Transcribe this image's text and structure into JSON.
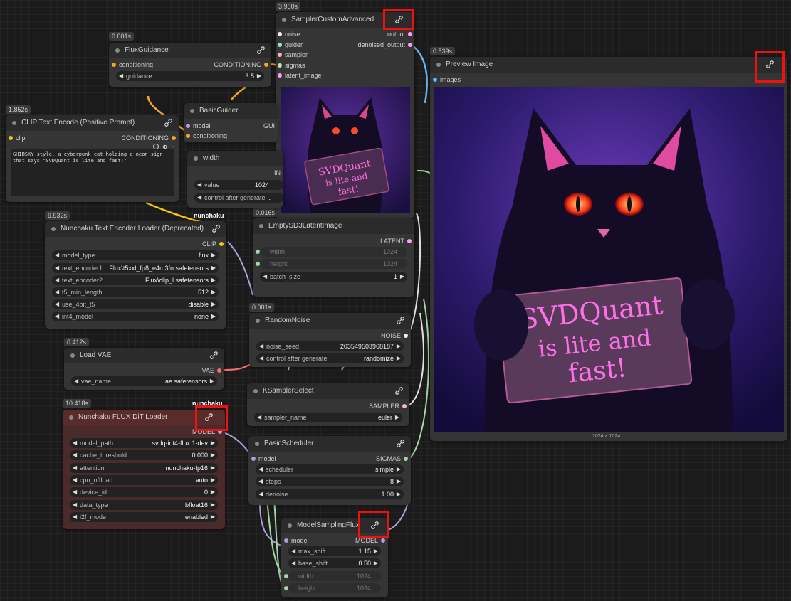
{
  "timings": {
    "sampler": "3.950s",
    "flux_guidance": "0.001s",
    "clip_text": "1.852s",
    "preview": "0.539s",
    "text_loader": "9.932s",
    "latent": "0.016s",
    "random_noise": "0.001s",
    "load_vae": "0.412s",
    "dit_loader": "10.418s"
  },
  "nodes": {
    "sampler": {
      "title": "SamplerCustomAdvanced",
      "inputs": [
        "noise",
        "guider",
        "sampler",
        "sigmas",
        "latent_image"
      ],
      "outputs": [
        "output",
        "denoised_output"
      ]
    },
    "flux_guidance": {
      "title": "FluxGuidance",
      "input": "conditioning",
      "output": "CONDITIONING",
      "guidance_label": "guidance",
      "guidance_value": "3.5"
    },
    "basic_guider": {
      "title": "BasicGuider",
      "inputs": [
        "model",
        "conditioning"
      ],
      "output": "GUI"
    },
    "clip_text": {
      "title": "CLIP Text Encode (Positive Prompt)",
      "input": "clip",
      "output": "CONDITIONING",
      "prompt": "GHIBSKY style, a cyberpunk cat holding a neon sign that says \"SVDQuant is lite and fast!\""
    },
    "width": {
      "title": "width",
      "output": "IN",
      "value_label": "value",
      "value": "1024",
      "control_label": "control after generate",
      "control_value": "."
    },
    "preview": {
      "title": "Preview Image",
      "input": "images",
      "size_label": "1024 × 1024"
    },
    "text_loader": {
      "title": "Nunchaku Text Encoder Loader (Deprecated)",
      "output": "CLIP",
      "widgets": [
        {
          "label": "model_type",
          "value": "flux"
        },
        {
          "label": "text_encoder1",
          "value": "Flux\\t5xxl_fp8_e4m3fn.safetensors"
        },
        {
          "label": "text_encoder2",
          "value": "Flux\\clip_l.safetensors"
        },
        {
          "label": "t5_min_length",
          "value": "512"
        },
        {
          "label": "use_4bit_t5",
          "value": "disable"
        },
        {
          "label": "int4_model",
          "value": "none"
        }
      ]
    },
    "latent": {
      "title": "EmptySD3LatentImage",
      "output": "LATENT",
      "widgets": [
        {
          "label": "width",
          "value": "1024",
          "dim": true
        },
        {
          "label": "height",
          "value": "1024",
          "dim": true
        },
        {
          "label": "batch_size",
          "value": "1",
          "dim": false
        }
      ]
    },
    "random_noise": {
      "title": "RandomNoise",
      "output": "NOISE",
      "widgets": [
        {
          "label": "noise_seed",
          "value": "203549503968187"
        },
        {
          "label": "control after generate",
          "value": "randomize"
        }
      ]
    },
    "load_vae": {
      "title": "Load VAE",
      "output": "VAE",
      "widgets": [
        {
          "label": "vae_name",
          "value": "ae.safetensors"
        }
      ]
    },
    "ksampler_select": {
      "title": "KSamplerSelect",
      "output": "SAMPLER",
      "widgets": [
        {
          "label": "sampler_name",
          "value": "euler"
        }
      ]
    },
    "dit_loader": {
      "title": "Nunchaku FLUX DiT Loader",
      "output": "MODEL",
      "widgets": [
        {
          "label": "model_path",
          "value": "svdq-int4-flux.1-dev"
        },
        {
          "label": "cache_threshold",
          "value": "0.000"
        },
        {
          "label": "attention",
          "value": "nunchaku-fp16"
        },
        {
          "label": "cpu_offload",
          "value": "auto"
        },
        {
          "label": "device_id",
          "value": "0"
        },
        {
          "label": "data_type",
          "value": "bfloat16"
        },
        {
          "label": "i2f_mode",
          "value": "enabled"
        }
      ]
    },
    "basic_scheduler": {
      "title": "BasicScheduler",
      "input": "model",
      "output": "SIGMAS",
      "widgets": [
        {
          "label": "scheduler",
          "value": "simple"
        },
        {
          "label": "steps",
          "value": "8"
        },
        {
          "label": "denoise",
          "value": "1.00"
        }
      ]
    },
    "model_sampling": {
      "title": "ModelSamplingFlux",
      "input": "model",
      "output": "MODEL",
      "widgets": [
        {
          "label": "max_shift",
          "value": "1.15",
          "dim": false
        },
        {
          "label": "base_shift",
          "value": "0.50",
          "dim": false
        },
        {
          "label": "width",
          "value": "1024",
          "dim": true
        },
        {
          "label": "height",
          "value": "1024",
          "dim": true
        }
      ]
    }
  },
  "floating_labels": {
    "nunchaku1": "nunchaku",
    "nunchaku2": "nunchaku"
  },
  "image": {
    "sign_line1": "SVDQuant",
    "sign_line2": "is lite and",
    "sign_line3": "fast!"
  },
  "colors": {
    "accent_red": "#e11111",
    "conditioning": "#f5a623",
    "clip": "#f5c518",
    "model": "#b39ddb",
    "vae": "#ff6b6b",
    "latent": "#ff9cf9",
    "image": "#64b5f6"
  },
  "icons": {
    "link": "link-icon"
  }
}
